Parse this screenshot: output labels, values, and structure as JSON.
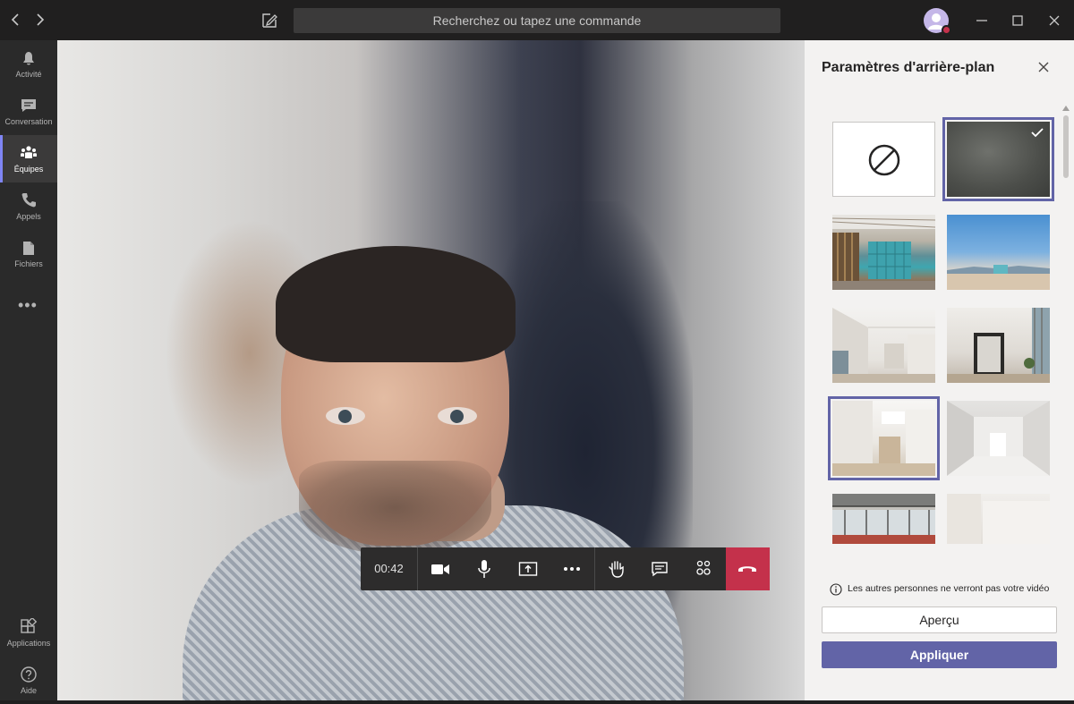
{
  "window": {
    "back_icon": "chevron-left-icon",
    "forward_icon": "chevron-right-icon",
    "compose_icon": "compose-icon",
    "search_placeholder": "Recherchez ou tapez une commande",
    "status_color": "#c4314b"
  },
  "rail": {
    "items": [
      {
        "label": "Activité",
        "icon": "bell-icon"
      },
      {
        "label": "Conversation",
        "icon": "chat-icon"
      },
      {
        "label": "Équipes",
        "icon": "teams-icon",
        "active": true
      },
      {
        "label": "Appels",
        "icon": "phone-icon"
      },
      {
        "label": "Fichiers",
        "icon": "file-icon"
      }
    ],
    "more": "•••",
    "bottom": [
      {
        "label": "Applications",
        "icon": "apps-icon"
      },
      {
        "label": "Aide",
        "icon": "help-icon"
      }
    ]
  },
  "call": {
    "timer": "00:42",
    "buttons": [
      "camera-icon",
      "microphone-icon",
      "share-screen-icon",
      "more-icon",
      "raise-hand-icon",
      "chat-icon",
      "participants-icon",
      "hang-up-icon"
    ],
    "hangup_color": "#c4314b"
  },
  "background_panel": {
    "title": "Paramètres d'arrière-plan",
    "selected_index": 1,
    "thumbnails": [
      "none",
      "blur",
      "office-loft",
      "beach",
      "white-room-1",
      "white-room-2",
      "white-room-3",
      "white-room-4",
      "office-windows",
      "white-wall"
    ],
    "info_text": "Les autres personnes ne verront pas votre vidéo",
    "preview_label": "Aperçu",
    "apply_label": "Appliquer",
    "accent_color": "#6264a7"
  }
}
